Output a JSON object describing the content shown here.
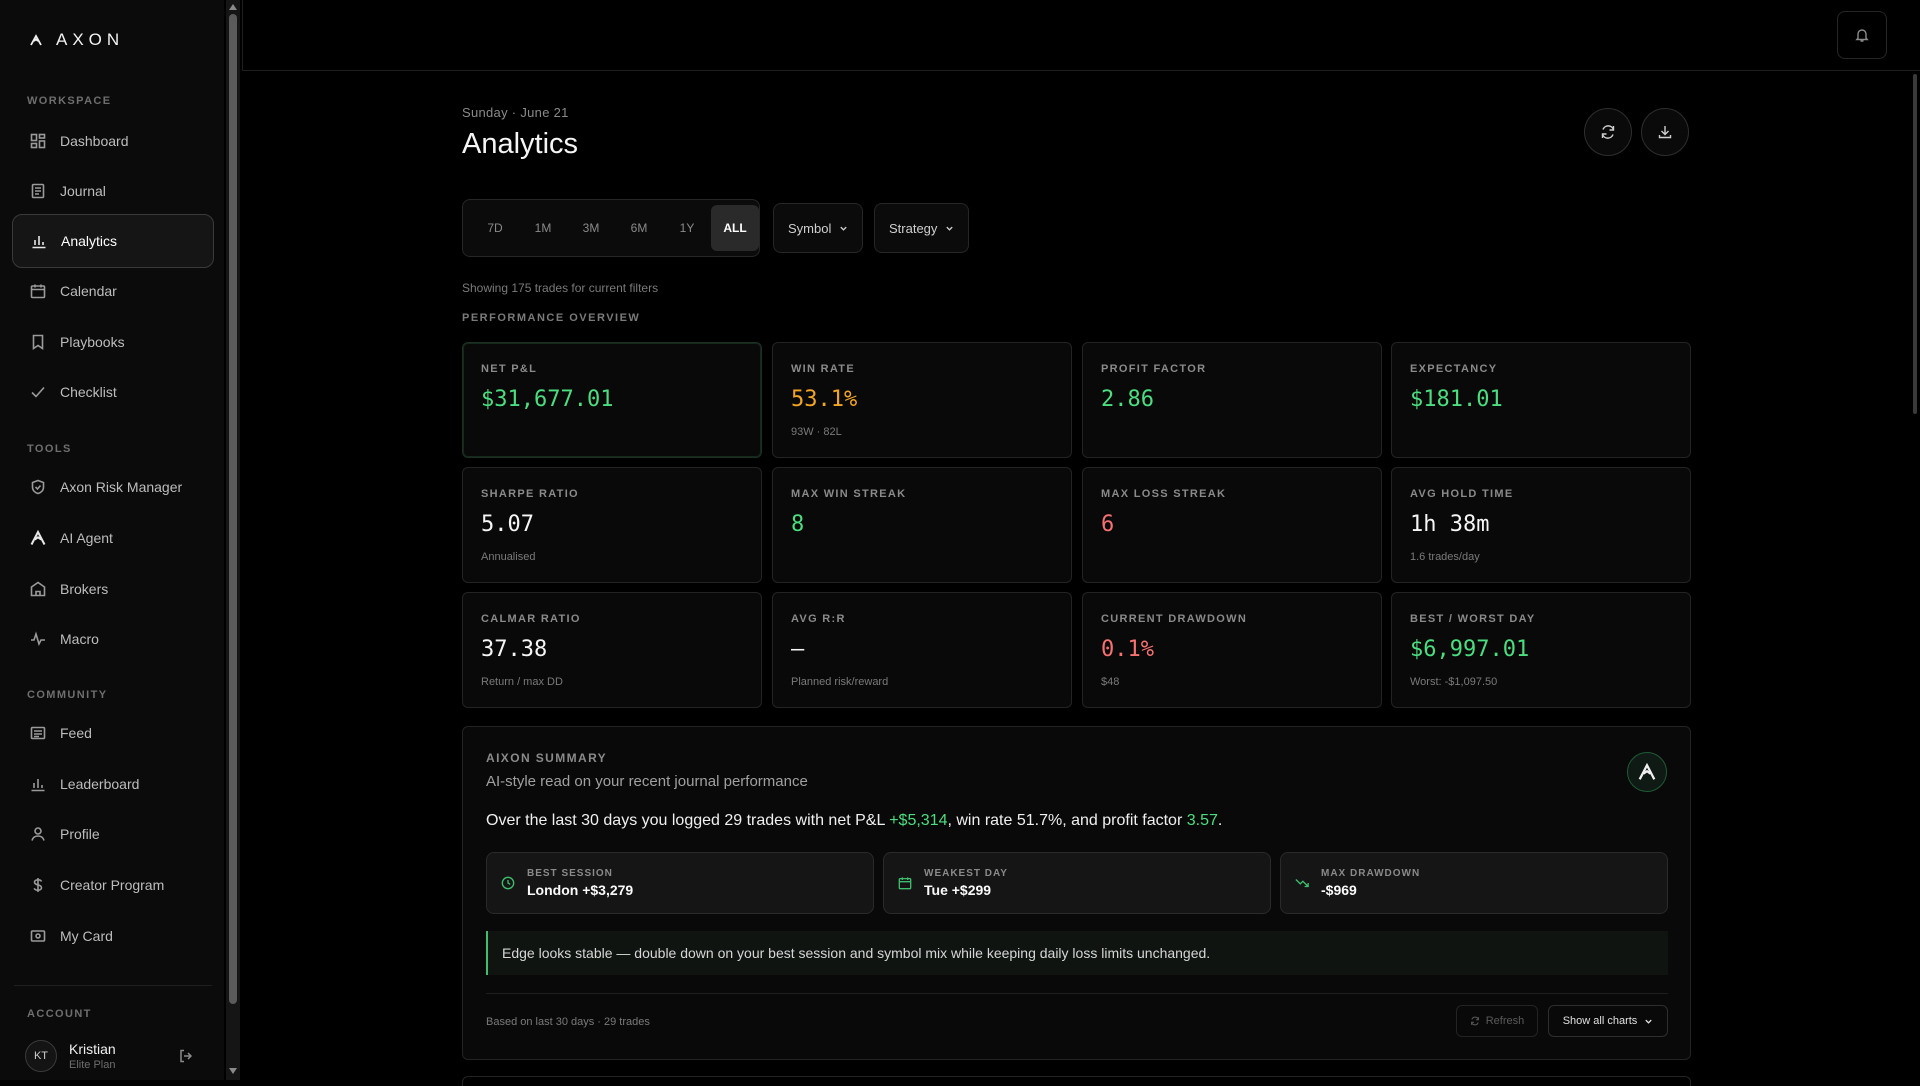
{
  "app": {
    "logo_text": "AXON"
  },
  "sidebar": {
    "sections": {
      "workspace": "WORKSPACE",
      "tools": "TOOLS",
      "community": "COMMUNITY",
      "account": "ACCOUNT"
    },
    "items": [
      {
        "label": "Dashboard",
        "icon": "grid-icon",
        "active": false
      },
      {
        "label": "Journal",
        "icon": "document-icon",
        "active": false
      },
      {
        "label": "Analytics",
        "icon": "bar-chart-icon",
        "active": true
      },
      {
        "label": "Calendar",
        "icon": "calendar-icon",
        "active": false
      },
      {
        "label": "Playbooks",
        "icon": "bookmark-icon",
        "active": false
      },
      {
        "label": "Checklist",
        "icon": "check-icon",
        "active": false
      },
      {
        "label": "Axon Risk Manager",
        "icon": "shield-icon",
        "active": false
      },
      {
        "label": "AI Agent",
        "icon": "axon-logo-icon",
        "active": false
      },
      {
        "label": "Brokers",
        "icon": "bank-icon",
        "active": false
      },
      {
        "label": "Macro",
        "icon": "pulse-icon",
        "active": false
      },
      {
        "label": "Feed",
        "icon": "newspaper-icon",
        "active": false
      },
      {
        "label": "Leaderboard",
        "icon": "bar-chart-icon",
        "active": false
      },
      {
        "label": "Profile",
        "icon": "user-icon",
        "active": false
      },
      {
        "label": "Creator Program",
        "icon": "dollar-icon",
        "active": false
      },
      {
        "label": "My Card",
        "icon": "card-icon",
        "active": false
      }
    ],
    "user": {
      "initials": "KT",
      "name": "Kristian",
      "plan": "Elite Plan"
    }
  },
  "header": {
    "date": "Sunday · June 21",
    "title": "Analytics"
  },
  "filters": {
    "ranges": [
      "7D",
      "1M",
      "3M",
      "6M",
      "1Y",
      "ALL"
    ],
    "selected_range": "ALL",
    "symbol_label": "Symbol",
    "strategy_label": "Strategy",
    "showing_text": "Showing 175 trades for current filters"
  },
  "overview": {
    "label": "PERFORMANCE OVERVIEW",
    "cards": [
      {
        "label": "NET P&L",
        "value": "$31,677.01",
        "sub": "",
        "color": "#4ade80"
      },
      {
        "label": "WIN RATE",
        "value": "53.1%",
        "sub": "93W · 82L",
        "color": "#f5a524"
      },
      {
        "label": "PROFIT FACTOR",
        "value": "2.86",
        "sub": "",
        "color": "#4ade80"
      },
      {
        "label": "EXPECTANCY",
        "value": "$181.01",
        "sub": "",
        "color": "#4ade80"
      },
      {
        "label": "SHARPE RATIO",
        "value": "5.07",
        "sub": "Annualised",
        "color": "#f5f5f5"
      },
      {
        "label": "MAX WIN STREAK",
        "value": "8",
        "sub": "",
        "color": "#4ade80"
      },
      {
        "label": "MAX LOSS STREAK",
        "value": "6",
        "sub": "",
        "color": "#f87171"
      },
      {
        "label": "AVG HOLD TIME",
        "value": "1h 38m",
        "sub": "1.6 trades/day",
        "color": "#f5f5f5"
      },
      {
        "label": "CALMAR RATIO",
        "value": "37.38",
        "sub": "Return / max DD",
        "color": "#f5f5f5"
      },
      {
        "label": "AVG R:R",
        "value": "—",
        "sub": "Planned risk/reward",
        "color": "#f5f5f5"
      },
      {
        "label": "CURRENT DRAWDOWN",
        "value": "0.1%",
        "sub": "$48",
        "color": "#f87171"
      },
      {
        "label": "BEST / WORST DAY",
        "value": "$6,997.01",
        "sub": "Worst: -$1,097.50",
        "color": "#4ade80"
      }
    ]
  },
  "summary": {
    "label": "AIXON SUMMARY",
    "subtitle": "AI-style read on your recent journal performance",
    "text_prefix": "Over the last 30 days you logged 29 trades with net P&L ",
    "net_pnl": "+$5,314",
    "text_mid": ", win rate 51.7%, and profit factor ",
    "profit_factor": "3.57",
    "text_suffix": ".",
    "stats": [
      {
        "title": "BEST SESSION",
        "value": "London +$3,279",
        "icon": "clock-icon"
      },
      {
        "title": "WEAKEST DAY",
        "value": "Tue +$299",
        "icon": "calendar-icon"
      },
      {
        "title": "MAX DRAWDOWN",
        "value": "-$969",
        "icon": "trending-down-icon"
      }
    ],
    "advice": "Edge looks stable — double down on your best session and symbol mix while keeping daily loss limits unchanged.",
    "based_on": "Based on last 30 days · 29 trades",
    "refresh_label": "Refresh",
    "show_charts_label": "Show all charts"
  }
}
